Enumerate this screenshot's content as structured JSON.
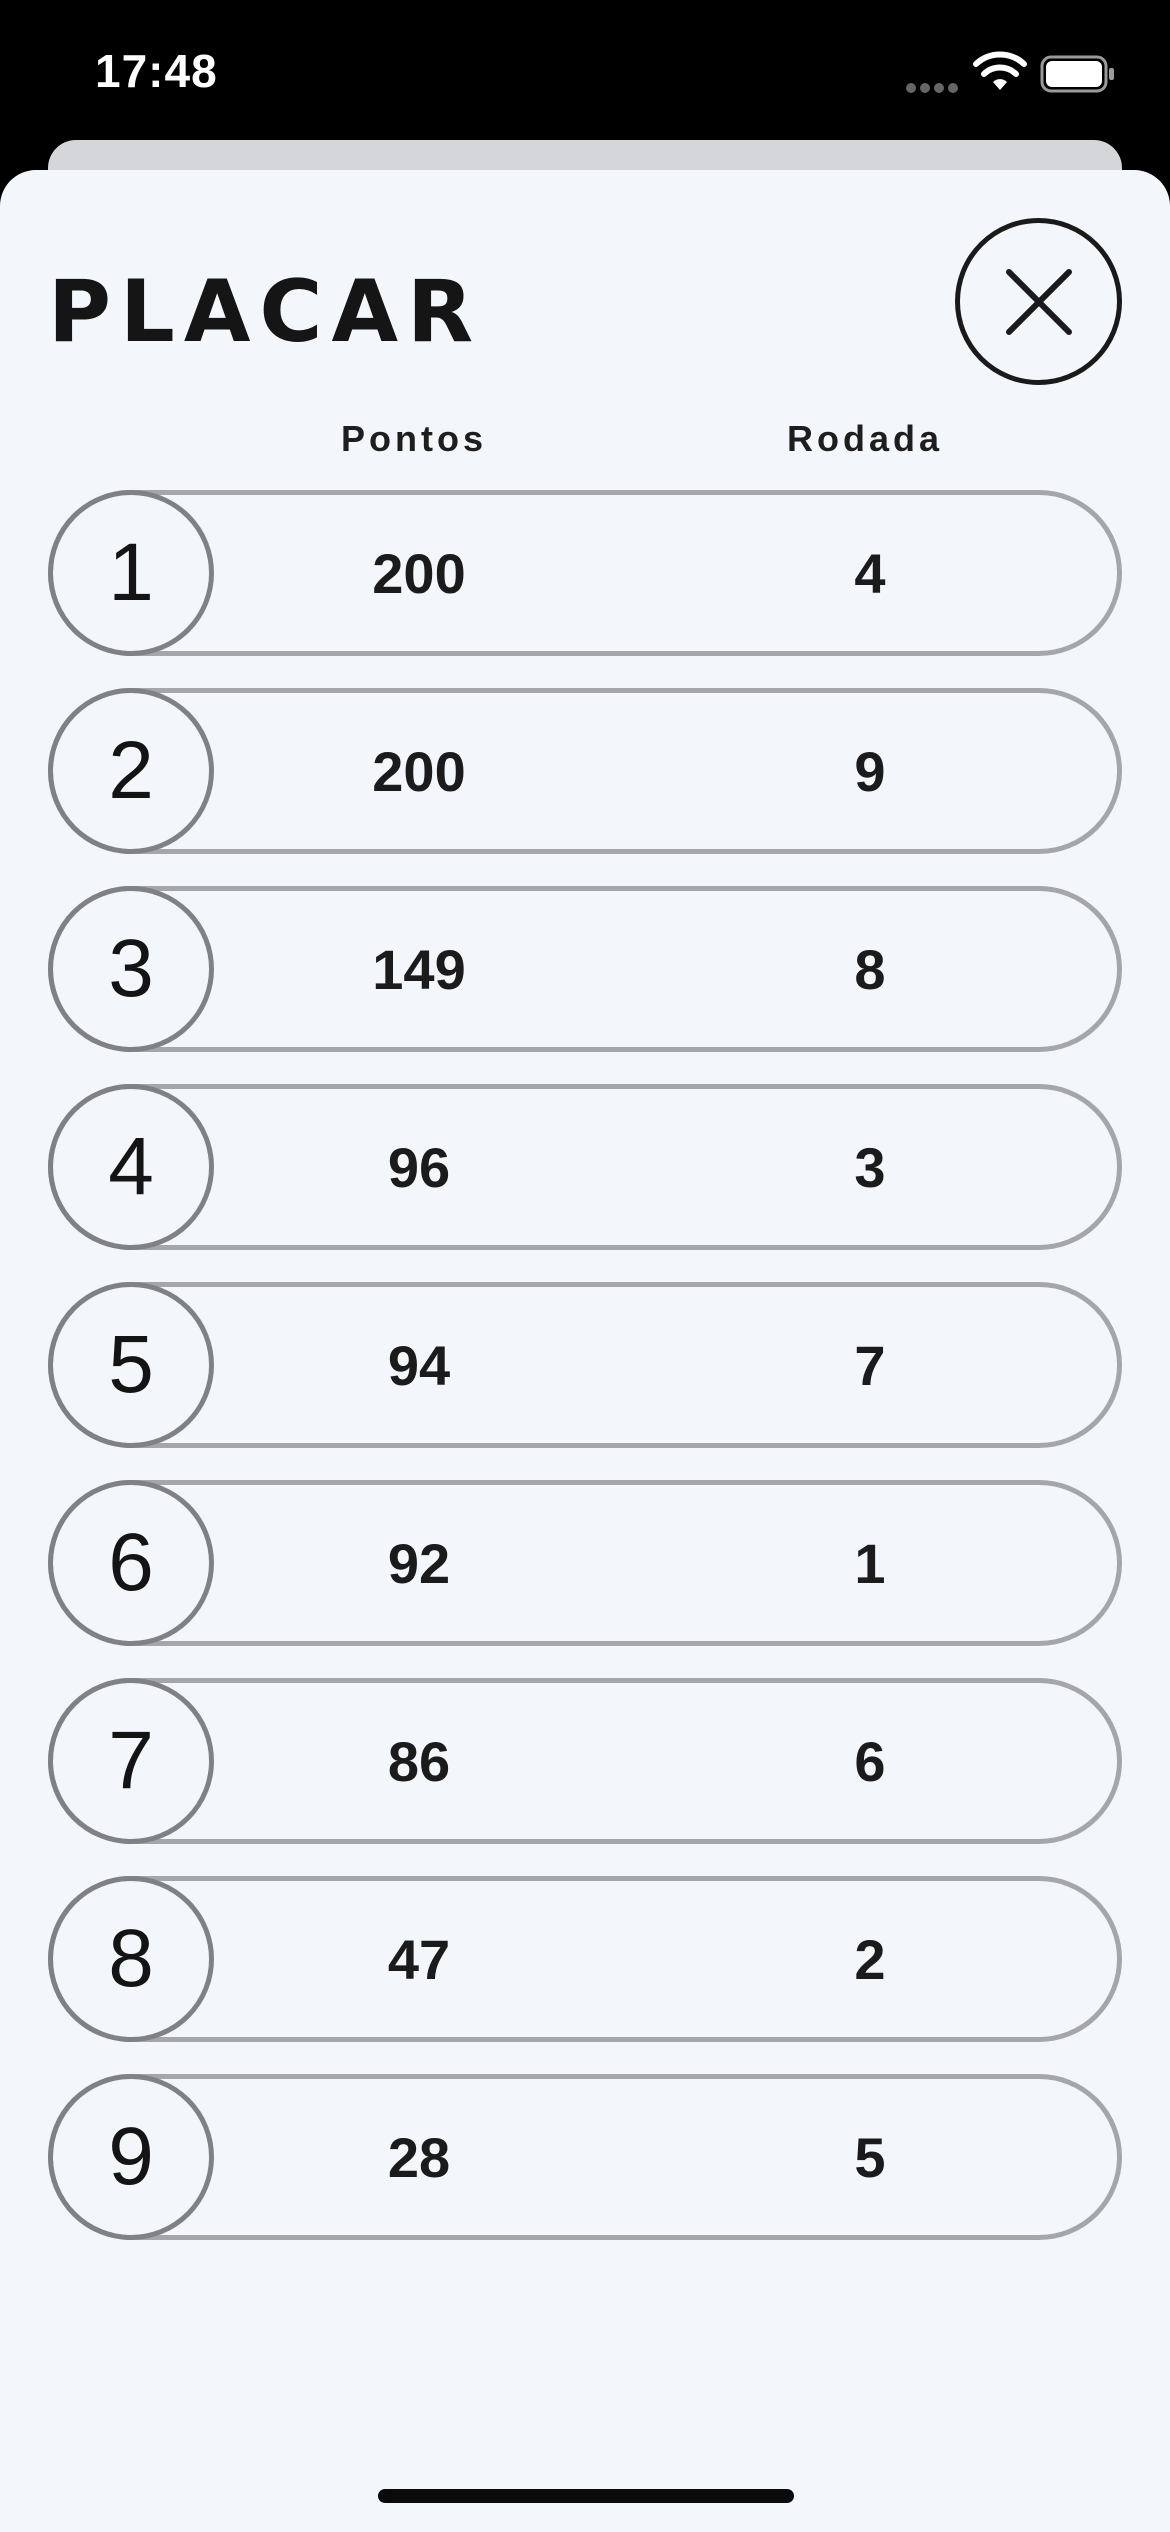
{
  "status_bar": {
    "time": "17:48"
  },
  "header": {
    "title": "PLACAR",
    "close_icon": "close-x-icon"
  },
  "columns": {
    "points": "Pontos",
    "round": "Rodada"
  },
  "rows": [
    {
      "rank": "1",
      "points": "200",
      "round": "4"
    },
    {
      "rank": "2",
      "points": "200",
      "round": "9"
    },
    {
      "rank": "3",
      "points": "149",
      "round": "8"
    },
    {
      "rank": "4",
      "points": "96",
      "round": "3"
    },
    {
      "rank": "5",
      "points": "94",
      "round": "7"
    },
    {
      "rank": "6",
      "points": "92",
      "round": "1"
    },
    {
      "rank": "7",
      "points": "86",
      "round": "6"
    },
    {
      "rank": "8",
      "points": "47",
      "round": "2"
    },
    {
      "rank": "9",
      "points": "28",
      "round": "5"
    }
  ],
  "colors": {
    "sheet_background": "#f3f7fb",
    "row_border": "#a4a6aa",
    "rank_border": "#7f8185",
    "text": "#151515"
  }
}
